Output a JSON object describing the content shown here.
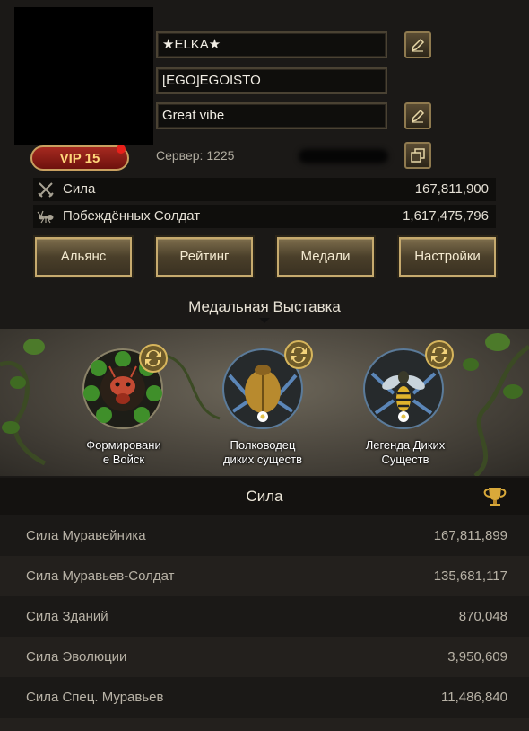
{
  "profile": {
    "name": "★ELKA★",
    "alliance_tag": "[EGO]EGOISTO",
    "motto": "Great vibe",
    "vip_label": "VIP 15",
    "server_label": "Сервер: 1225"
  },
  "stats": [
    {
      "label": "Сила",
      "value": "167,811,900",
      "icon": "crossed-swords-icon"
    },
    {
      "label": "Побеждённых Солдат",
      "value": "1,617,475,796",
      "icon": "ant-icon"
    }
  ],
  "tabs": [
    "Альянс",
    "Рейтинг",
    "Медали",
    "Настройки"
  ],
  "medal_section": {
    "title": "Медальная Выставка",
    "medals": [
      {
        "label_line1": "Формировани",
        "label_line2": "е Войск",
        "icon": "clover-ant-medal-icon"
      },
      {
        "label_line1": "Полководец",
        "label_line2": "диких существ",
        "icon": "beetle-medal-icon"
      },
      {
        "label_line1": "Легенда Диких",
        "label_line2": "Существ",
        "icon": "wasp-medal-icon"
      }
    ]
  },
  "power": {
    "title": "Сила",
    "rows": [
      {
        "label": "Сила Муравейника",
        "value": "167,811,899"
      },
      {
        "label": "Сила Муравьев-Солдат",
        "value": "135,681,117"
      },
      {
        "label": "Сила Зданий",
        "value": "870,048"
      },
      {
        "label": "Сила Эволюции",
        "value": "3,950,609"
      },
      {
        "label": "Сила Спец. Муравьев",
        "value": "11,486,840"
      }
    ]
  },
  "colors": {
    "accent_gold": "#c6aa6e",
    "vip_red": "#a52a20",
    "background": "#1b1917"
  }
}
